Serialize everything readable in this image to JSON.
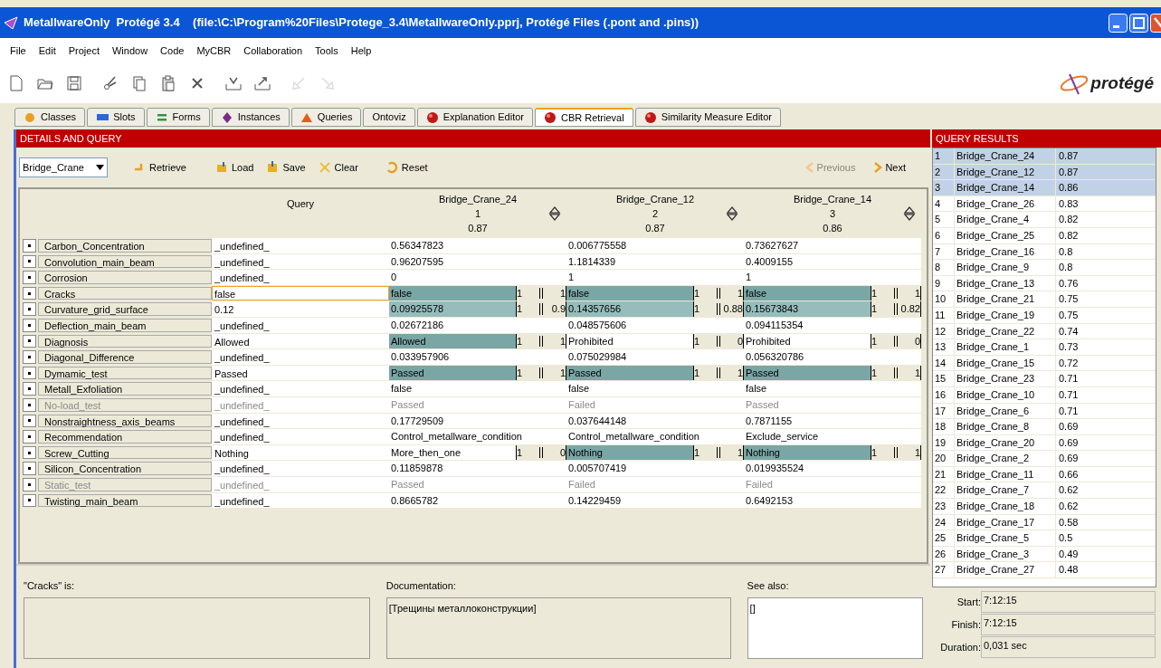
{
  "window": {
    "title": "MetallwareOnly  Protégé 3.4    (file:\\C:\\Program%20Files\\Protege_3.4\\MetallwareOnly.pprj, Protégé Files (.pont and .pins))"
  },
  "menu": [
    "File",
    "Edit",
    "Project",
    "Window",
    "Code",
    "MyCBR",
    "Collaboration",
    "Tools",
    "Help"
  ],
  "toolbar": [
    {
      "kind": "new",
      "disabled": false
    },
    {
      "kind": "open",
      "disabled": false
    },
    {
      "kind": "save",
      "disabled": false
    },
    {
      "kind": "cut",
      "disabled": false
    },
    {
      "kind": "copy",
      "disabled": false
    },
    {
      "kind": "paste",
      "disabled": false
    },
    {
      "kind": "delete",
      "disabled": false
    },
    {
      "kind": "import",
      "disabled": false
    },
    {
      "kind": "export",
      "disabled": false
    },
    {
      "kind": "undo",
      "disabled": true
    },
    {
      "kind": "redo",
      "disabled": true
    }
  ],
  "logo": {
    "text": "protégé"
  },
  "tabs": [
    {
      "label": "Classes",
      "kind": "dot",
      "selected": false
    },
    {
      "label": "Slots",
      "kind": "bar",
      "selected": false
    },
    {
      "label": "Forms",
      "kind": "lines",
      "selected": false
    },
    {
      "label": "Instances",
      "kind": "diamond",
      "selected": false
    },
    {
      "label": "Queries",
      "kind": "triangle",
      "selected": false
    },
    {
      "label": "Ontoviz",
      "kind": "plain",
      "selected": false
    },
    {
      "label": "Explanation Editor",
      "kind": "ball",
      "selected": false
    },
    {
      "label": "CBR Retrieval",
      "kind": "ball",
      "selected": true
    },
    {
      "label": "Similarity Measure Editor",
      "kind": "ball",
      "selected": false
    }
  ],
  "details_panel": {
    "title": "DETAILS AND QUERY",
    "concept": "Bridge_Crane",
    "buttons": [
      {
        "label": "Retrieve",
        "kind": "retrieve"
      },
      {
        "label": "Load",
        "kind": "load"
      },
      {
        "label": "Save",
        "kind": "save"
      },
      {
        "label": "Clear",
        "kind": "clear"
      },
      {
        "label": "Reset",
        "kind": "reset"
      }
    ],
    "nav": [
      {
        "label": "Previous",
        "disabled": true
      },
      {
        "label": "Next",
        "disabled": false
      }
    ]
  },
  "table": {
    "query_header": "Query",
    "cases": [
      {
        "name": "Bridge_Crane_24",
        "rank": "1",
        "score": "0.87"
      },
      {
        "name": "Bridge_Crane_12",
        "rank": "2",
        "score": "0.87"
      },
      {
        "name": "Bridge_Crane_14",
        "rank": "3",
        "score": "0.86"
      }
    ],
    "rows": [
      {
        "slot": "Carbon_Concentration",
        "disabled": false,
        "selected": false,
        "query": "_undefined_",
        "cells": [
          {
            "value": "0.56347823"
          },
          {
            "value": "0.006775558"
          },
          {
            "value": "0.73627627"
          }
        ]
      },
      {
        "slot": "Convolution_main_beam",
        "disabled": false,
        "selected": false,
        "query": "_undefined_",
        "cells": [
          {
            "value": "0.96207595"
          },
          {
            "value": "1.1814339"
          },
          {
            "value": "0.4009155"
          }
        ]
      },
      {
        "slot": "Corrosion",
        "disabled": false,
        "selected": false,
        "query": "_undefined_",
        "cells": [
          {
            "value": "0"
          },
          {
            "value": "1"
          },
          {
            "value": "1"
          }
        ]
      },
      {
        "slot": "Cracks",
        "disabled": false,
        "selected": true,
        "query": "false",
        "cells": [
          {
            "value": "false",
            "color": "#7aa6a6",
            "weight": "1",
            "similarity": "1"
          },
          {
            "value": "false",
            "color": "#7aa6a6",
            "weight": "1",
            "similarity": "1"
          },
          {
            "value": "false",
            "color": "#7aa6a6",
            "weight": "1",
            "similarity": "1"
          }
        ]
      },
      {
        "slot": "Curvature_grid_surface",
        "disabled": false,
        "selected": false,
        "query": "0.12",
        "cells": [
          {
            "value": "0.09925578",
            "color": "#96bcbc",
            "weight": "1",
            "similarity": "0.9"
          },
          {
            "value": "0.14357656",
            "color": "#96bcbc",
            "weight": "1",
            "similarity": "0.88"
          },
          {
            "value": "0.15673843",
            "color": "#96bcbc",
            "weight": "1",
            "similarity": "0.82"
          }
        ]
      },
      {
        "slot": "Deflection_main_beam",
        "disabled": false,
        "selected": false,
        "query": "_undefined_",
        "cells": [
          {
            "value": "0.02672186"
          },
          {
            "value": "0.048575606"
          },
          {
            "value": "0.094115354"
          }
        ]
      },
      {
        "slot": "Diagnosis",
        "disabled": false,
        "selected": false,
        "query": "Allowed",
        "cells": [
          {
            "value": "Allowed",
            "color": "#7aa6a6",
            "weight": "1",
            "similarity": "1"
          },
          {
            "value": "Prohibited",
            "color": "#ffffff",
            "weight": "1",
            "similarity": "0"
          },
          {
            "value": "Prohibited",
            "color": "#ffffff",
            "weight": "1",
            "similarity": "0"
          }
        ]
      },
      {
        "slot": "Diagonal_Difference",
        "disabled": false,
        "selected": false,
        "query": "_undefined_",
        "cells": [
          {
            "value": "0.033957906"
          },
          {
            "value": "0.075029984"
          },
          {
            "value": "0.056320786"
          }
        ]
      },
      {
        "slot": "Dymamic_test",
        "disabled": false,
        "selected": false,
        "query": "Passed",
        "cells": [
          {
            "value": "Passed",
            "color": "#7aa6a6",
            "weight": "1",
            "similarity": "1"
          },
          {
            "value": "Passed",
            "color": "#7aa6a6",
            "weight": "1",
            "similarity": "1"
          },
          {
            "value": "Passed",
            "color": "#7aa6a6",
            "weight": "1",
            "similarity": "1"
          }
        ]
      },
      {
        "slot": "Metall_Exfoliation",
        "disabled": false,
        "selected": false,
        "query": "_undefined_",
        "cells": [
          {
            "value": "false"
          },
          {
            "value": "false"
          },
          {
            "value": "false"
          }
        ]
      },
      {
        "slot": "No-load_test",
        "disabled": true,
        "selected": false,
        "query": "_undefined_",
        "cells": [
          {
            "value": "Passed"
          },
          {
            "value": "Failed"
          },
          {
            "value": "Passed"
          }
        ]
      },
      {
        "slot": "Nonstraightness_axis_beams",
        "disabled": false,
        "selected": false,
        "query": "_undefined_",
        "cells": [
          {
            "value": "0.17729509"
          },
          {
            "value": "0.037644148"
          },
          {
            "value": "0.7871155"
          }
        ]
      },
      {
        "slot": "Recommendation",
        "disabled": false,
        "selected": false,
        "query": "_undefined_",
        "cells": [
          {
            "value": "Control_metallware_condition"
          },
          {
            "value": "Control_metallware_condition"
          },
          {
            "value": "Exclude_service"
          }
        ]
      },
      {
        "slot": "Screw_Cutting",
        "disabled": false,
        "selected": false,
        "query": "Nothing",
        "cells": [
          {
            "value": "More_then_one",
            "color": "#ffffff",
            "weight": "1",
            "similarity": "0"
          },
          {
            "value": "Nothing",
            "color": "#7aa6a6",
            "weight": "1",
            "similarity": "1"
          },
          {
            "value": "Nothing",
            "color": "#7aa6a6",
            "weight": "1",
            "similarity": "1"
          }
        ]
      },
      {
        "slot": "Silicon_Concentration",
        "disabled": false,
        "selected": false,
        "query": "_undefined_",
        "cells": [
          {
            "value": "0.11859878"
          },
          {
            "value": "0.005707419"
          },
          {
            "value": "0.019935524"
          }
        ]
      },
      {
        "slot": "Static_test",
        "disabled": true,
        "selected": false,
        "query": "_undefined_",
        "cells": [
          {
            "value": "Passed"
          },
          {
            "value": "Failed"
          },
          {
            "value": "Failed"
          }
        ]
      },
      {
        "slot": "Twisting_main_beam",
        "disabled": false,
        "selected": false,
        "query": "_undefined_",
        "cells": [
          {
            "value": "0.8665782"
          },
          {
            "value": "0.14229459"
          },
          {
            "value": "0.6492153"
          }
        ]
      }
    ]
  },
  "info": {
    "is_label": "\"Cracks\" is:",
    "documentation_label": "Documentation:",
    "documentation": "[Трещины металлоконструкции]",
    "see_also_label": "See also:",
    "see_also": "[]"
  },
  "results_panel": {
    "title": "QUERY RESULTS",
    "results": [
      {
        "rank": "1",
        "name": "Bridge_Crane_24",
        "score": "0.87",
        "selected": true
      },
      {
        "rank": "2",
        "name": "Bridge_Crane_12",
        "score": "0.87",
        "selected": true
      },
      {
        "rank": "3",
        "name": "Bridge_Crane_14",
        "score": "0.86",
        "selected": true
      },
      {
        "rank": "4",
        "name": "Bridge_Crane_26",
        "score": "0.83",
        "selected": false
      },
      {
        "rank": "5",
        "name": "Bridge_Crane_4",
        "score": "0.82",
        "selected": false
      },
      {
        "rank": "6",
        "name": "Bridge_Crane_25",
        "score": "0.82",
        "selected": false
      },
      {
        "rank": "7",
        "name": "Bridge_Crane_16",
        "score": "0.8",
        "selected": false
      },
      {
        "rank": "8",
        "name": "Bridge_Crane_9",
        "score": "0.8",
        "selected": false
      },
      {
        "rank": "9",
        "name": "Bridge_Crane_13",
        "score": "0.76",
        "selected": false
      },
      {
        "rank": "10",
        "name": "Bridge_Crane_21",
        "score": "0.75",
        "selected": false
      },
      {
        "rank": "11",
        "name": "Bridge_Crane_19",
        "score": "0.75",
        "selected": false
      },
      {
        "rank": "12",
        "name": "Bridge_Crane_22",
        "score": "0.74",
        "selected": false
      },
      {
        "rank": "13",
        "name": "Bridge_Crane_1",
        "score": "0.73",
        "selected": false
      },
      {
        "rank": "14",
        "name": "Bridge_Crane_15",
        "score": "0.72",
        "selected": false
      },
      {
        "rank": "15",
        "name": "Bridge_Crane_23",
        "score": "0.71",
        "selected": false
      },
      {
        "rank": "16",
        "name": "Bridge_Crane_10",
        "score": "0.71",
        "selected": false
      },
      {
        "rank": "17",
        "name": "Bridge_Crane_6",
        "score": "0.71",
        "selected": false
      },
      {
        "rank": "18",
        "name": "Bridge_Crane_8",
        "score": "0.69",
        "selected": false
      },
      {
        "rank": "19",
        "name": "Bridge_Crane_20",
        "score": "0.69",
        "selected": false
      },
      {
        "rank": "20",
        "name": "Bridge_Crane_2",
        "score": "0.69",
        "selected": false
      },
      {
        "rank": "21",
        "name": "Bridge_Crane_11",
        "score": "0.66",
        "selected": false
      },
      {
        "rank": "22",
        "name": "Bridge_Crane_7",
        "score": "0.62",
        "selected": false
      },
      {
        "rank": "23",
        "name": "Bridge_Crane_18",
        "score": "0.62",
        "selected": false
      },
      {
        "rank": "24",
        "name": "Bridge_Crane_17",
        "score": "0.58",
        "selected": false
      },
      {
        "rank": "25",
        "name": "Bridge_Crane_5",
        "score": "0.5",
        "selected": false
      },
      {
        "rank": "26",
        "name": "Bridge_Crane_3",
        "score": "0.49",
        "selected": false
      },
      {
        "rank": "27",
        "name": "Bridge_Crane_27",
        "score": "0.48",
        "selected": false
      }
    ],
    "timing": [
      {
        "label": "Start:",
        "value": "7:12:15"
      },
      {
        "label": "Finish:",
        "value": "7:12:15"
      },
      {
        "label": "Duration:",
        "value": "0,031 sec"
      }
    ]
  }
}
